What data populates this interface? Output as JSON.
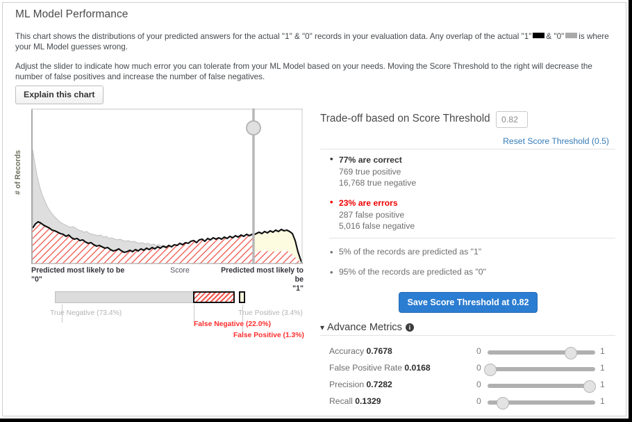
{
  "header": {
    "title": "ML Model Performance"
  },
  "description": {
    "p1_a": "This chart shows the distributions of your predicted answers for the actual \"1\" & \"0\" records in your evaluation data. Any overlap of the actual \"1\"",
    "p1_b": "& \"0\"",
    "p1_c": "is where your ML Model guesses wrong.",
    "p2": "Adjust the slider to indicate how much error you can tolerate from your ML Model based on your needs. Moving the Score Threshold to the right will decrease the number of false positives and increase the number of false negatives."
  },
  "buttons": {
    "explain": "Explain this chart",
    "save_threshold": "Save Score Threshold at 0.82"
  },
  "chart_axes": {
    "ylabel": "# of Records",
    "xlabel_mid": "Score",
    "xlabel_left": "Predicted most likely to be",
    "xlabel_left_value": "\"0\"",
    "xlabel_right": "Predicted most likely to be",
    "xlabel_right_value": "\"1\""
  },
  "ratio_bar": {
    "true_negative": "True Negative (73.4%)",
    "false_negative": "False Negative (22.0%)",
    "true_positive": "True Positive (3.4%)",
    "false_positive": "False Positive (1.3%)"
  },
  "tradeoff": {
    "title": "Trade-off based on Score Threshold",
    "threshold_value": "0.82",
    "threshold_placeholder": "0.5",
    "reset_link": "Reset Score Threshold (0.5)",
    "correct_head": "77% are correct",
    "correct_tp": "769 true positive",
    "correct_tn": "16,768 true negative",
    "errors_head": "23% are errors",
    "errors_fp": "287 false positive",
    "errors_fn": "5,016 false negative",
    "predicted_1": "5% of the records are predicted as \"1\"",
    "predicted_0": "95% of the records are predicted as \"0\""
  },
  "advance_metrics": {
    "caret": "▾",
    "title": "Advance Metrics",
    "info": "i",
    "min_label": "0",
    "max_label": "1",
    "rows": [
      {
        "name": "Accuracy",
        "value": "0.7678",
        "fraction": 0.7678
      },
      {
        "name": "False Positive Rate",
        "value": "0.0168",
        "fraction": 0.0168
      },
      {
        "name": "Precision",
        "value": "0.7282",
        "fraction": 0.94
      },
      {
        "name": "Recall",
        "value": "0.1329",
        "fraction": 0.1329
      }
    ]
  },
  "colors": {
    "accent_blue": "#2b7dd1",
    "error_red": "#ff2d2d",
    "actual_one": "#000000",
    "actual_zero": "#a9a9a9",
    "hatch_red": "#f2544b",
    "fill_yellow": "#fdfbe0",
    "fill_gray": "#dcdcdc"
  },
  "chart_data": {
    "type": "area",
    "title": "ML Model Performance",
    "xlabel": "Score",
    "ylabel": "# of Records",
    "xlim": [
      0,
      1
    ],
    "threshold": 0.82,
    "grid": false,
    "legend": [
      "actual \"1\"",
      "actual \"0\""
    ],
    "x": [
      0.0,
      0.02,
      0.04,
      0.06,
      0.08,
      0.1,
      0.12,
      0.14,
      0.16,
      0.18,
      0.2,
      0.22,
      0.24,
      0.26,
      0.28,
      0.3,
      0.32,
      0.34,
      0.36,
      0.38,
      0.4,
      0.42,
      0.44,
      0.46,
      0.48,
      0.5,
      0.52,
      0.54,
      0.56,
      0.58,
      0.6,
      0.62,
      0.64,
      0.66,
      0.68,
      0.7,
      0.72,
      0.74,
      0.76,
      0.78,
      0.8,
      0.82,
      0.84,
      0.86,
      0.88,
      0.9,
      0.92,
      0.94,
      0.96,
      0.98,
      1.0
    ],
    "series": [
      {
        "name": "actual \"0\" (gray)",
        "values": [
          73,
          66,
          56,
          48,
          42,
          37,
          34,
          31,
          29,
          27,
          25,
          24,
          22,
          21,
          20,
          18,
          17,
          16,
          15,
          14,
          13,
          13,
          12,
          12,
          11,
          11,
          10,
          10,
          10,
          9,
          9,
          9,
          9,
          9,
          8,
          8,
          8,
          9,
          9,
          9,
          8,
          8,
          7,
          7,
          6,
          6,
          6,
          6,
          5,
          4,
          1
        ]
      },
      {
        "name": "actual \"1\" (black outline / red hatch)",
        "values": [
          24,
          27,
          26,
          24,
          23,
          22,
          21,
          20,
          19,
          18,
          17,
          16,
          16,
          15,
          14,
          14,
          13,
          12,
          12,
          11,
          11,
          12,
          12,
          13,
          13,
          14,
          14,
          15,
          14,
          15,
          16,
          16,
          17,
          18,
          17,
          17,
          18,
          18,
          17,
          17,
          18,
          18,
          17,
          18,
          18,
          18,
          18,
          17,
          16,
          10,
          1
        ]
      }
    ]
  }
}
